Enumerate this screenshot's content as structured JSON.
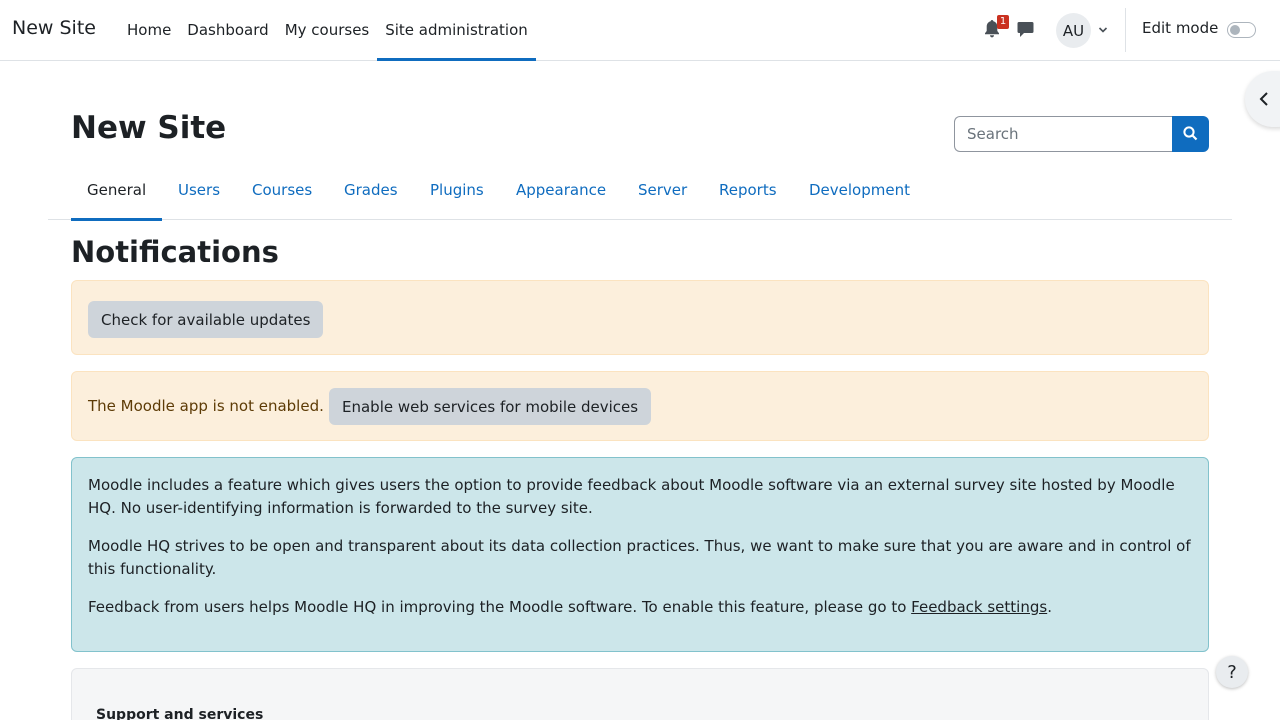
{
  "navbar": {
    "brand": "New Site",
    "items": [
      {
        "label": "Home"
      },
      {
        "label": "Dashboard"
      },
      {
        "label": "My courses"
      },
      {
        "label": "Site administration",
        "active": true
      }
    ],
    "notification_count": "1",
    "avatar_initials": "AU",
    "edit_mode_label": "Edit mode",
    "edit_mode_on": false,
    "icons": [
      "bell-icon",
      "chat-icon",
      "chevron-down-icon"
    ]
  },
  "header": {
    "title": "New Site",
    "search_placeholder": "Search"
  },
  "tabs": [
    {
      "label": "General",
      "active": true
    },
    {
      "label": "Users"
    },
    {
      "label": "Courses"
    },
    {
      "label": "Grades"
    },
    {
      "label": "Plugins"
    },
    {
      "label": "Appearance"
    },
    {
      "label": "Server"
    },
    {
      "label": "Reports"
    },
    {
      "label": "Development"
    }
  ],
  "main": {
    "section_title": "Notifications",
    "update_button": "Check for available updates",
    "app_message": "The Moodle app is not enabled.",
    "app_button": "Enable web services for mobile devices",
    "info_p1": "Moodle includes a feature which gives users the option to provide feedback about Moodle software via an external survey site hosted by Moodle HQ. No user-identifying information is forwarded to the survey site.",
    "info_p2": "Moodle HQ strives to be open and transparent about its data collection practices. Thus, we want to make sure that you are aware and in control of this functionality.",
    "info_p3_prefix": "Feedback from users helps Moodle HQ in improving the Moodle software. To enable this feature, please go to ",
    "info_p3_link": "Feedback settings",
    "info_p3_suffix": ".",
    "support_title": "Support and services"
  },
  "help_label": "?",
  "colors": {
    "accent": "#0f6cbf",
    "warning_bg": "#fcefdc",
    "info_bg": "#cce6ea",
    "badge": "#ca3120"
  }
}
